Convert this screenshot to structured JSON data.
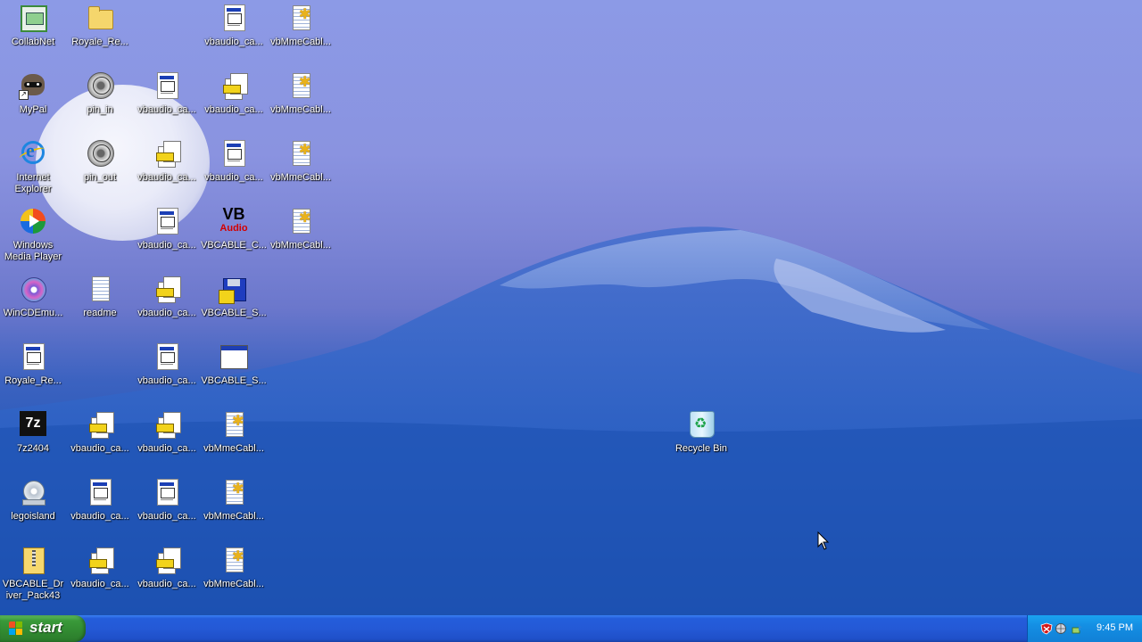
{
  "desktop": {
    "icons": [
      {
        "label": "CollabNet",
        "glyph": "collabnet-icon"
      },
      {
        "label": "Royale_Re...",
        "glyph": "folder-icon"
      },
      {
        "label": "vbaudio_ca...",
        "glyph": "document-icon"
      },
      {
        "label": "vbMmeCabl...",
        "glyph": "settings-file-icon"
      },
      {
        "label": "MyPal",
        "glyph": "mypal-icon"
      },
      {
        "label": "pin_in",
        "glyph": "speaker-icon"
      },
      {
        "label": "vbaudio_ca...",
        "glyph": "document-icon"
      },
      {
        "label": "vbaudio_ca...",
        "glyph": "installer-icon"
      },
      {
        "label": "vbMmeCabl...",
        "glyph": "settings-file-icon"
      },
      {
        "label": "Internet Explorer",
        "glyph": "internet-explorer-icon"
      },
      {
        "label": "pin_out",
        "glyph": "speaker-icon"
      },
      {
        "label": "vbaudio_ca...",
        "glyph": "installer-icon"
      },
      {
        "label": "vbaudio_ca...",
        "glyph": "document-icon"
      },
      {
        "label": "vbMmeCabl...",
        "glyph": "settings-file-icon"
      },
      {
        "label": "Windows Media Player",
        "glyph": "media-player-icon"
      },
      {
        "label": "vbaudio_ca...",
        "glyph": "document-icon"
      },
      {
        "label": "VBCABLE_C...",
        "glyph": "vb-audio-icon"
      },
      {
        "label": "vbMmeCabl...",
        "glyph": "settings-file-icon"
      },
      {
        "label": "WinCDEmu...",
        "glyph": "wincdemu-icon"
      },
      {
        "label": "readme",
        "glyph": "text-file-icon"
      },
      {
        "label": "vbaudio_ca...",
        "glyph": "installer-icon"
      },
      {
        "label": "VBCABLE_S...",
        "glyph": "setup-floppy-icon"
      },
      {
        "label": "Royale_Re...",
        "glyph": "document-icon"
      },
      {
        "label": "vbaudio_ca...",
        "glyph": "document-icon"
      },
      {
        "label": "VBCABLE_S...",
        "glyph": "app-window-icon"
      },
      {
        "label": "7z2404",
        "glyph": "7zip-icon"
      },
      {
        "label": "vbaudio_ca...",
        "glyph": "installer-icon"
      },
      {
        "label": "vbaudio_ca...",
        "glyph": "installer-icon"
      },
      {
        "label": "vbMmeCabl...",
        "glyph": "settings-file-icon"
      },
      {
        "label": "legoisland",
        "glyph": "disc-icon"
      },
      {
        "label": "vbaudio_ca...",
        "glyph": "document-icon"
      },
      {
        "label": "vbaudio_ca...",
        "glyph": "document-icon"
      },
      {
        "label": "vbMmeCabl...",
        "glyph": "settings-file-icon"
      },
      {
        "label": "VBCABLE_Driver_Pack43",
        "glyph": "zip-folder-icon"
      },
      {
        "label": "vbaudio_ca...",
        "glyph": "installer-icon"
      },
      {
        "label": "vbaudio_ca...",
        "glyph": "installer-icon"
      },
      {
        "label": "vbMmeCabl...",
        "glyph": "settings-file-icon"
      },
      {
        "label": "Recycle Bin",
        "glyph": "recycle-bin-icon"
      }
    ]
  },
  "taskbar": {
    "start_label": "start",
    "clock": "9:45 PM",
    "tray_icons": [
      "security-alert-icon",
      "network-icon",
      "safely-remove-icon"
    ]
  },
  "colors": {
    "taskbar_blue": "#245ddb",
    "start_green": "#3a9a3a",
    "tray_blue": "#148ee3"
  }
}
